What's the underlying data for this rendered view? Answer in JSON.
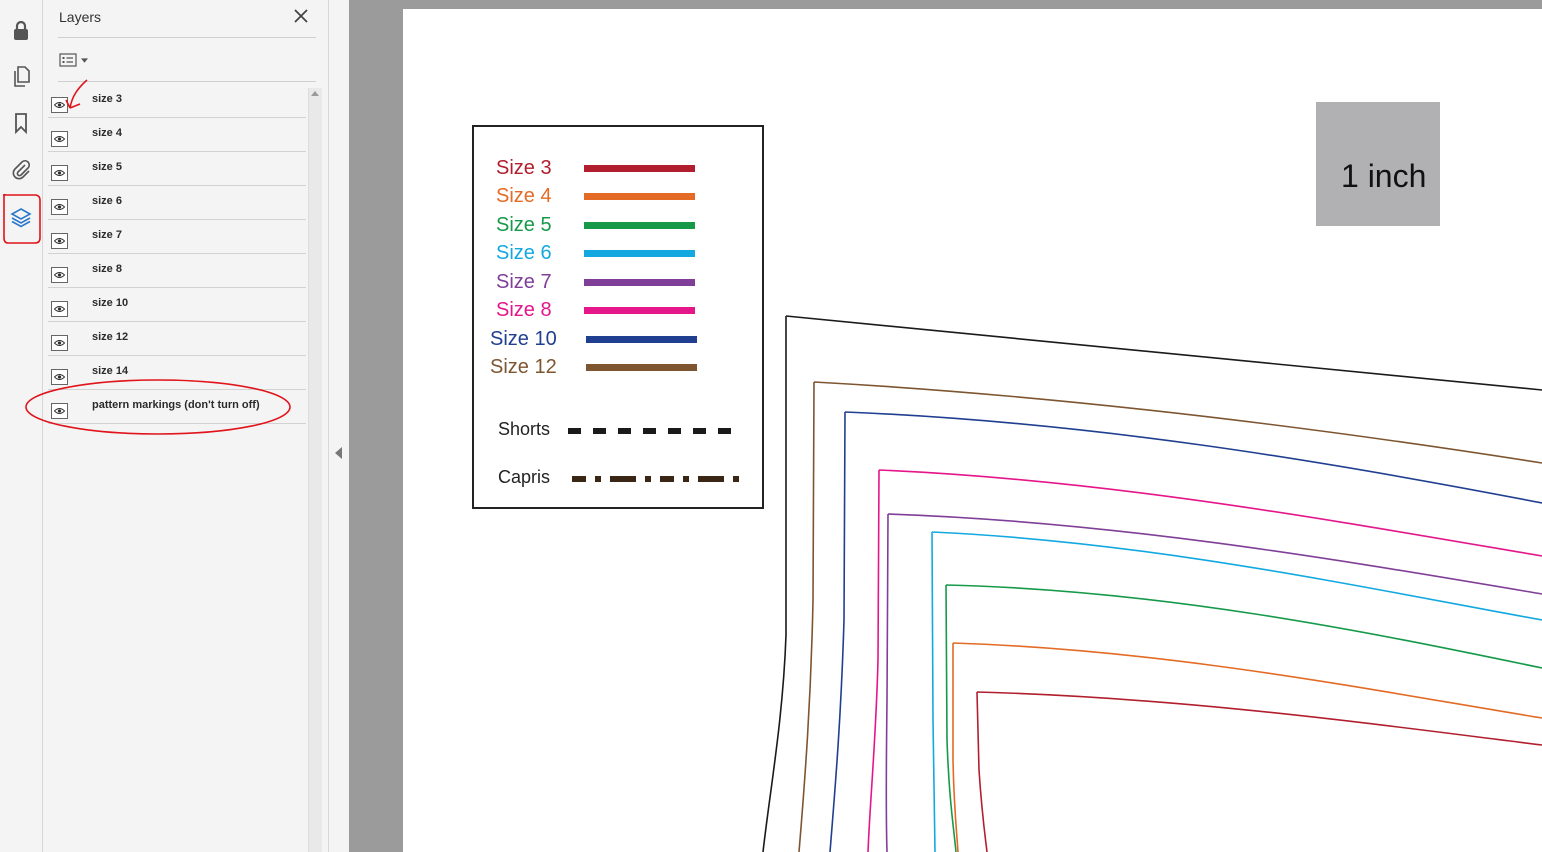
{
  "rail": {
    "icons": [
      "lock-icon",
      "pages-icon",
      "bookmark-icon",
      "attachment-icon",
      "layers-icon"
    ]
  },
  "layers_panel": {
    "title": "Layers",
    "layers": [
      {
        "label": "size 3",
        "visible": true
      },
      {
        "label": "size 4",
        "visible": true
      },
      {
        "label": "size 5",
        "visible": true
      },
      {
        "label": "size 6",
        "visible": true
      },
      {
        "label": "size 7",
        "visible": true
      },
      {
        "label": "size 8",
        "visible": true
      },
      {
        "label": "size 10",
        "visible": true
      },
      {
        "label": "size 12",
        "visible": true
      },
      {
        "label": "size 14",
        "visible": true
      },
      {
        "label": "pattern markings (don't turn off)",
        "visible": true
      }
    ]
  },
  "document": {
    "legend": {
      "sizes": [
        {
          "label": "Size 3",
          "color": "#b11f2e"
        },
        {
          "label": "Size 4",
          "color": "#e36b26"
        },
        {
          "label": "Size 5",
          "color": "#169a4a"
        },
        {
          "label": "Size 6",
          "color": "#13a9e0"
        },
        {
          "label": "Size 7",
          "color": "#7f3f98"
        },
        {
          "label": "Size 8",
          "color": "#e5158a"
        },
        {
          "label": "Size 10",
          "color": "#203f91"
        },
        {
          "label": "Size 12",
          "color": "#7e5531"
        }
      ],
      "shorts_label": "Shorts",
      "capris_label": "Capris"
    },
    "scale_box_label": "1 inch",
    "outline_color": "#1a1a1a"
  },
  "annotation_color": "#e0141b"
}
